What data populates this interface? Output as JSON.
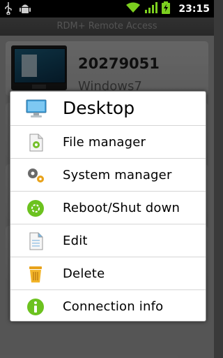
{
  "status_bar": {
    "time": "23:15",
    "icons": [
      "usb-icon",
      "android-debug-icon",
      "wifi-icon",
      "signal-icon",
      "battery-icon"
    ]
  },
  "app": {
    "title": "RDM+ Remote Access"
  },
  "device": {
    "id": "20279051",
    "os": "Windows7"
  },
  "menu": {
    "title": "Desktop",
    "items": [
      {
        "label": "File manager",
        "icon": "file-manager-icon"
      },
      {
        "label": "System manager",
        "icon": "system-manager-icon"
      },
      {
        "label": "Reboot/Shut down",
        "icon": "reboot-icon"
      },
      {
        "label": "Edit",
        "icon": "edit-icon"
      },
      {
        "label": "Delete",
        "icon": "delete-icon"
      },
      {
        "label": "Connection info",
        "icon": "info-icon"
      }
    ]
  },
  "colors": {
    "accent_green": "#6cc21f",
    "status_bar_bg": "#000000",
    "menu_bg": "#ffffff"
  }
}
